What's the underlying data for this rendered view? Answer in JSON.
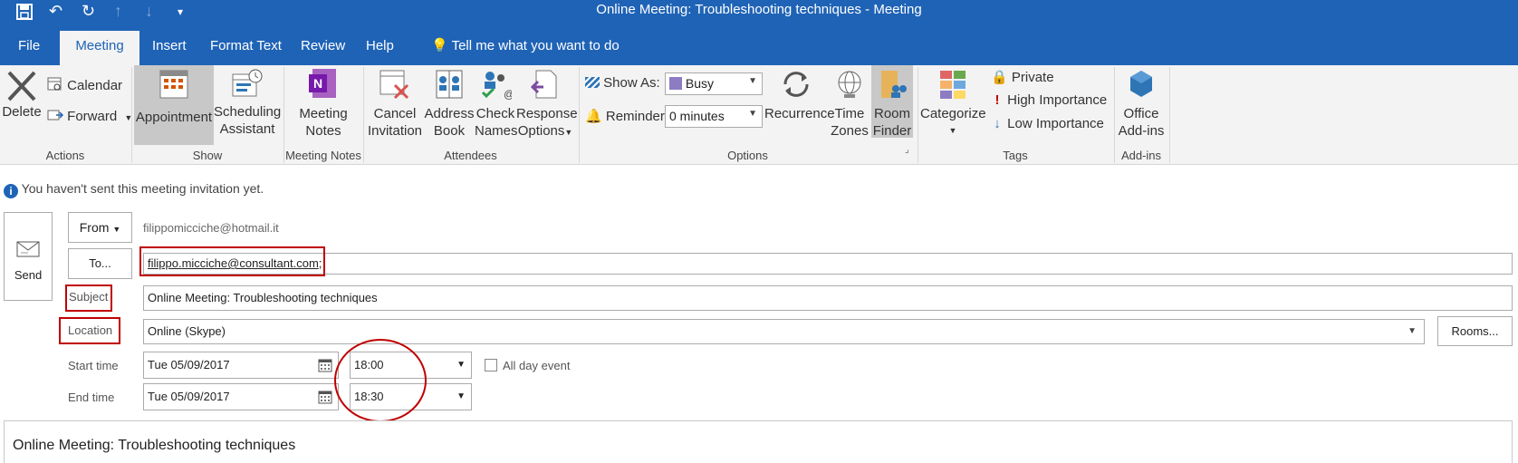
{
  "window": {
    "title": "Online Meeting: Troubleshooting techniques   -  Meeting"
  },
  "qat": {
    "save": "save-icon",
    "undo": "undo-icon",
    "redo": "redo-icon",
    "more": "▾"
  },
  "tabs": [
    "File",
    "Meeting",
    "Insert",
    "Format Text",
    "Review",
    "Help"
  ],
  "tell_me": "Tell me what you want to do",
  "ribbon": {
    "delete": "Delete",
    "calendar": "Calendar",
    "forward": "Forward",
    "actions_group": "Actions",
    "appointment": "Appointment",
    "scheduling_1": "Scheduling",
    "scheduling_2": "Assistant",
    "show_group": "Show",
    "meeting_notes_1": "Meeting",
    "meeting_notes_2": "Notes",
    "meeting_notes_group": "Meeting Notes",
    "cancel_1": "Cancel",
    "cancel_2": "Invitation",
    "address_1": "Address",
    "address_2": "Book",
    "check_1": "Check",
    "check_2": "Names",
    "response_1": "Response",
    "response_2": "Options",
    "attendees_group": "Attendees",
    "show_as_label": "Show As:",
    "show_as_value": "Busy",
    "reminder_label": "Reminder:",
    "reminder_value": "0 minutes",
    "recurrence": "Recurrence",
    "time_zones_1": "Time",
    "time_zones_2": "Zones",
    "room_finder_1": "Room",
    "room_finder_2": "Finder",
    "options_group": "Options",
    "categorize": "Categorize",
    "private": "Private",
    "high_importance": "High Importance",
    "low_importance": "Low Importance",
    "tags_group": "Tags",
    "office_1": "Office",
    "office_2": "Add-ins",
    "addins_group": "Add-ins"
  },
  "info": "You haven't sent this meeting invitation yet.",
  "form": {
    "send": "Send",
    "from_button": "From",
    "from_value": "filippomicciche@hotmail.it",
    "to_button": "To...",
    "to_value": "filippo.micciche@consultant.com",
    "to_suffix": ";",
    "subject_label": "Subject",
    "subject_value": "Online Meeting: Troubleshooting techniques",
    "location_label": "Location",
    "location_value": "Online (Skype)",
    "rooms_button": "Rooms...",
    "start_label": "Start time",
    "start_date": "Tue 05/09/2017",
    "start_time": "18:00",
    "all_day": "All day event",
    "end_label": "End time",
    "end_date": "Tue 05/09/2017",
    "end_time": "18:30"
  },
  "body_text": "Online Meeting: Troubleshooting techniques",
  "colors": {
    "accent": "#1f63b6",
    "annotation": "#c00000"
  }
}
